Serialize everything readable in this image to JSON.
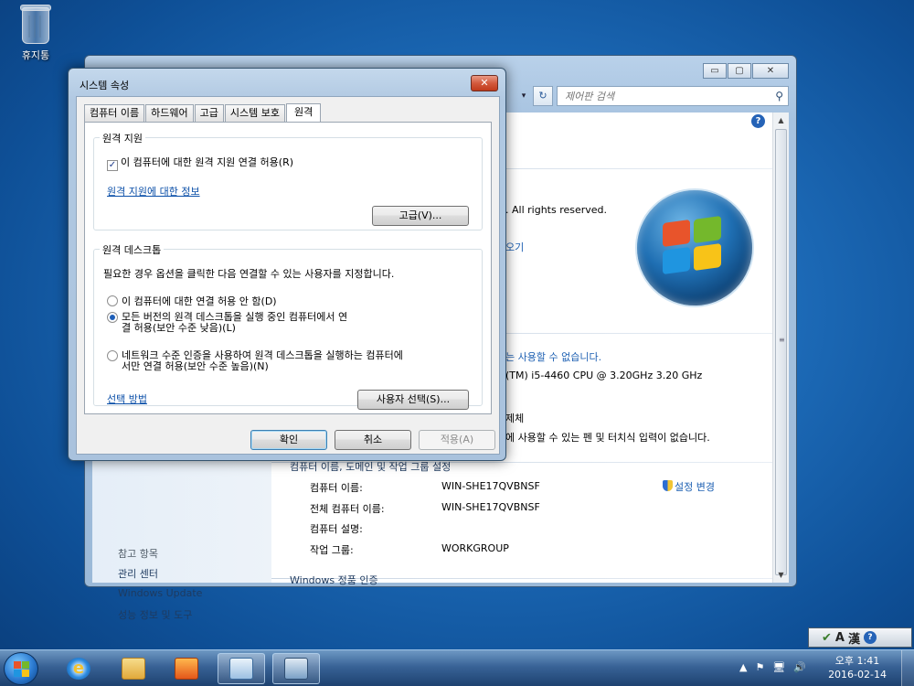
{
  "desktop": {
    "recycle_bin_label": "휴지통"
  },
  "control_panel": {
    "caption": {
      "minimize": "▭",
      "maximize": "▢",
      "close": "✕"
    },
    "nav_arrow": "▾",
    "refresh_symbol": "↻",
    "search_placeholder": "제어판 검색",
    "rights_text": ". All rights reserved.",
    "link_more": "오기",
    "pen_text": "는 사용할 수 없습니다.",
    "cpu_text": "(TM) i5-4460  CPU @ 3.20GHz   3.20 GHz",
    "limit_text": "제체",
    "touch_text": "에 사용할 수 있는 펜 및 터치식 입력이 없습니다.",
    "section_name": "컴퓨터 이름, 도메인 및 작업 그룹 설정",
    "rows": [
      {
        "label": "컴퓨터 이름:",
        "value": "WIN-SHE17QVBNSF"
      },
      {
        "label": "전체 컴퓨터 이름:",
        "value": "WIN-SHE17QVBNSF"
      },
      {
        "label": "컴퓨터 설명:",
        "value": ""
      },
      {
        "label": "작업 그룹:",
        "value": "WORKGROUP"
      }
    ],
    "change_settings": "설정 변경",
    "activation": "Windows 정품 인증",
    "see_also_title": "참고 항목",
    "see_also": [
      "관리 센터",
      "Windows Update",
      "성능 정보 및 도구"
    ]
  },
  "dialog": {
    "title": "시스템 속성",
    "close": "✕",
    "tabs": [
      "컴퓨터 이름",
      "하드웨어",
      "고급",
      "시스템 보호",
      "원격"
    ],
    "active_tab": "원격",
    "remote_assistance": {
      "title": "원격 지원",
      "checkbox_label": "이 컴퓨터에 대한 원격 지원 연결 허용(R)",
      "checked": true,
      "info_link": "원격 지원에 대한 정보",
      "advanced_button": "고급(V)..."
    },
    "remote_desktop": {
      "title": "원격 데스크톱",
      "instruction": "필요한 경우 옵션을 클릭한 다음 연결할 수 있는 사용자를 지정합니다.",
      "option1": "이 컴퓨터에 대한 연결 허용 안 함(D)",
      "option2_line1": "모든 버전의 원격 데스크톱을 실행 중인 컴퓨터에서 연",
      "option2_line2": "결 허용(보안 수준 낮음)(L)",
      "option3_line1": "네트워크 수준 인증을 사용하여 원격 데스크톱을 실행하는 컴퓨터에",
      "option3_line2": "서만 연결 허용(보안 수준 높음)(N)",
      "selected_option": 2,
      "help_link": "선택 방법",
      "select_users_button": "사용자 선택(S)..."
    },
    "buttons": {
      "ok": "확인",
      "cancel": "취소",
      "apply": "적용(A)"
    }
  },
  "taskbar": {
    "ie_letter": "e",
    "language_bar": {
      "a": "A",
      "han": "漢",
      "help": "?"
    },
    "tray_icons": [
      "▲",
      "⚑",
      "🖥",
      "🔊"
    ],
    "clock_time": "오후 1:41",
    "clock_date": "2016-02-14"
  },
  "colors": {
    "link_blue": "#0b4fa8",
    "close_red": "#c03a1b",
    "desktop_blue": "#1d6bb8"
  }
}
